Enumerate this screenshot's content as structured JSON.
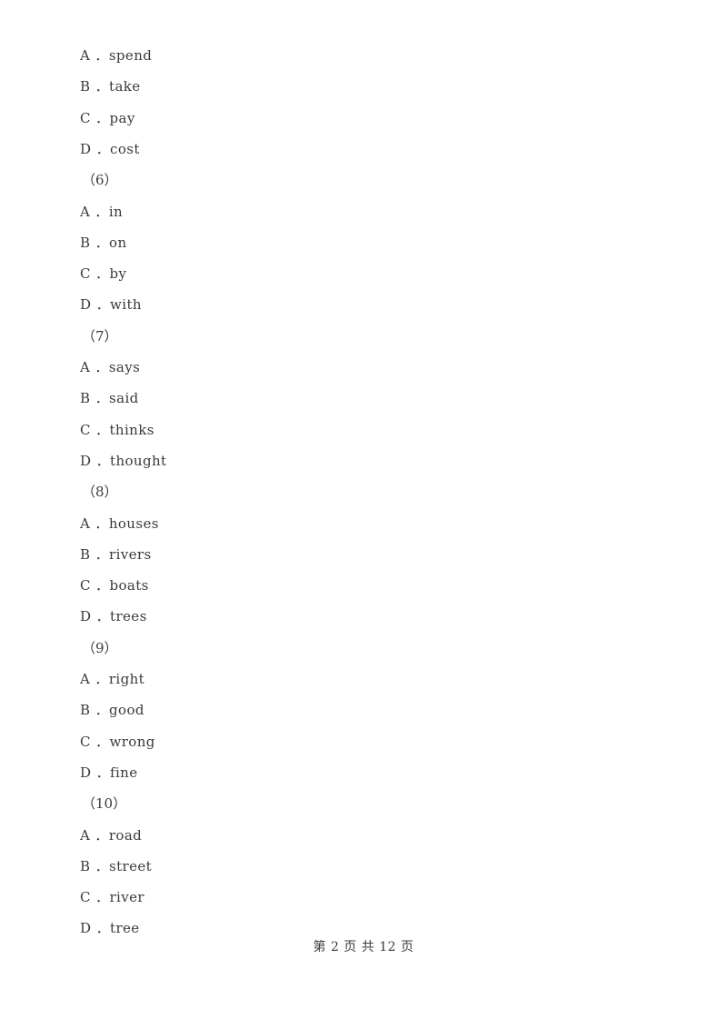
{
  "document": {
    "page_background": "#ffffff",
    "text_color": "#3a3a3a",
    "separator": " ．"
  },
  "body": {
    "lines": [
      {
        "kind": "option",
        "letter": "A",
        "text": "spend"
      },
      {
        "kind": "option",
        "letter": "B",
        "text": "take"
      },
      {
        "kind": "option",
        "letter": "C",
        "text": "pay"
      },
      {
        "kind": "option",
        "letter": "D",
        "text": "cost"
      },
      {
        "kind": "qnum",
        "label": "（6）"
      },
      {
        "kind": "option",
        "letter": "A",
        "text": "in"
      },
      {
        "kind": "option",
        "letter": "B",
        "text": "on"
      },
      {
        "kind": "option",
        "letter": "C",
        "text": "by"
      },
      {
        "kind": "option",
        "letter": "D",
        "text": "with"
      },
      {
        "kind": "qnum",
        "label": "（7）"
      },
      {
        "kind": "option",
        "letter": "A",
        "text": "says"
      },
      {
        "kind": "option",
        "letter": "B",
        "text": "said"
      },
      {
        "kind": "option",
        "letter": "C",
        "text": "thinks"
      },
      {
        "kind": "option",
        "letter": "D",
        "text": "thought"
      },
      {
        "kind": "qnum",
        "label": "（8）"
      },
      {
        "kind": "option",
        "letter": "A",
        "text": "houses"
      },
      {
        "kind": "option",
        "letter": "B",
        "text": "rivers"
      },
      {
        "kind": "option",
        "letter": "C",
        "text": "boats"
      },
      {
        "kind": "option",
        "letter": "D",
        "text": "trees"
      },
      {
        "kind": "qnum",
        "label": "（9）"
      },
      {
        "kind": "option",
        "letter": "A",
        "text": "right"
      },
      {
        "kind": "option",
        "letter": "B",
        "text": "good"
      },
      {
        "kind": "option",
        "letter": "C",
        "text": "wrong"
      },
      {
        "kind": "option",
        "letter": "D",
        "text": "fine"
      },
      {
        "kind": "qnum",
        "label": "（10）"
      },
      {
        "kind": "option",
        "letter": "A",
        "text": "road"
      },
      {
        "kind": "option",
        "letter": "B",
        "text": "street"
      },
      {
        "kind": "option",
        "letter": "C",
        "text": "river"
      },
      {
        "kind": "option",
        "letter": "D",
        "text": "tree"
      }
    ]
  },
  "footer": {
    "page_label": "第 2 页 共 12 页",
    "current_page": "2",
    "total_pages": "12"
  }
}
